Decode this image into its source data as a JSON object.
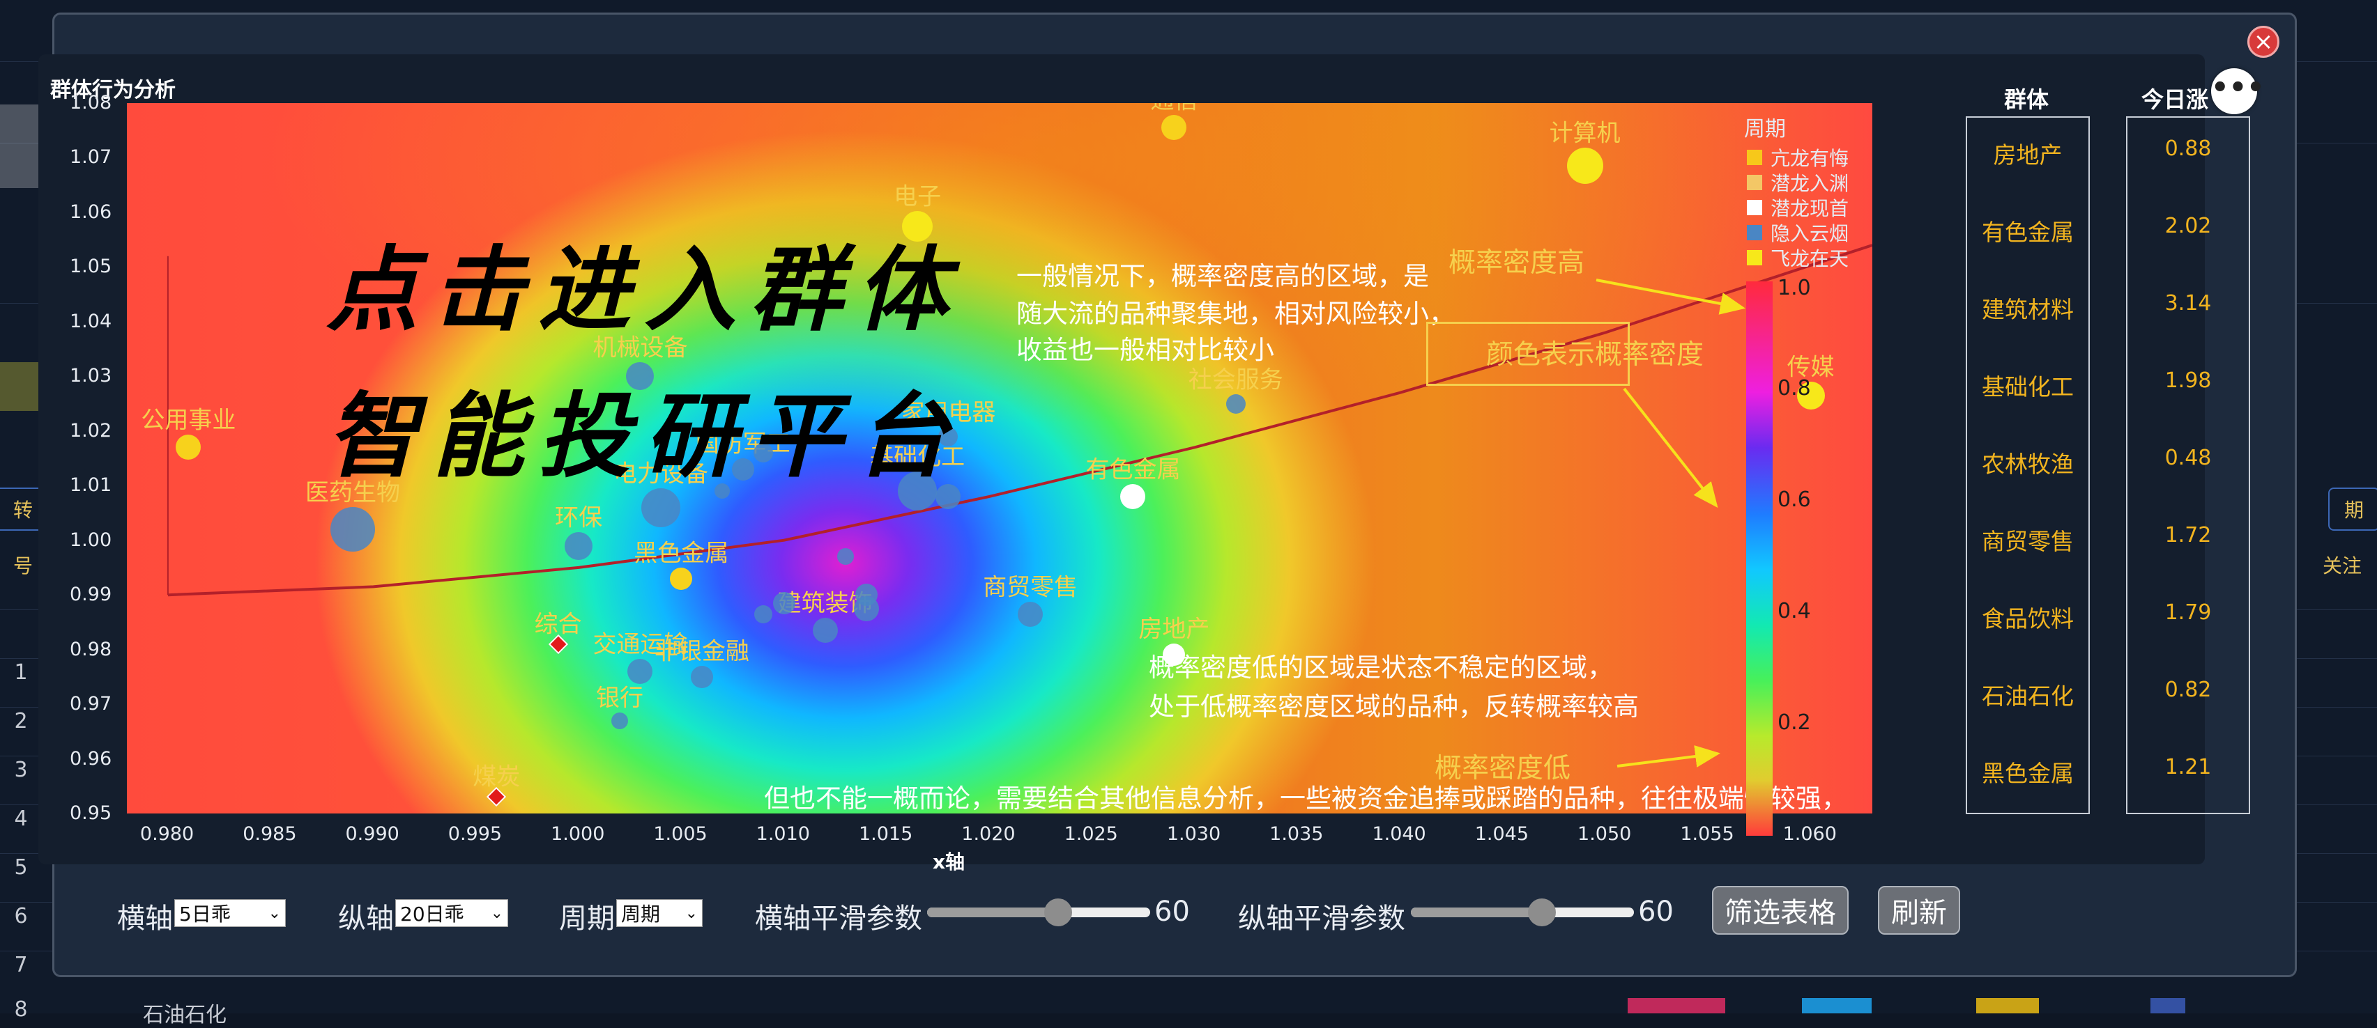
{
  "background": {
    "row_numbers": [
      "1",
      "2",
      "3",
      "4",
      "5",
      "6",
      "7",
      "8"
    ],
    "left_tags": [
      "转",
      "号"
    ],
    "right_tags": [
      "期",
      "关注"
    ],
    "bottom_row_text": "石油石化"
  },
  "modal": {
    "close_label": "×",
    "chart_title": "群体行为分析",
    "plot": {
      "x_axis_title": "x轴",
      "x_ticks": [
        "0.980",
        "0.985",
        "0.990",
        "0.995",
        "1.000",
        "1.005",
        "1.010",
        "1.015",
        "1.020",
        "1.025",
        "1.030",
        "1.035",
        "1.040",
        "1.045",
        "1.050",
        "1.055",
        "1.060"
      ],
      "y_ticks": [
        "1.08",
        "1.07",
        "1.06",
        "1.05",
        "1.04",
        "1.03",
        "1.02",
        "1.01",
        "1.00",
        "0.99",
        "0.98",
        "0.97",
        "0.96",
        "0.95"
      ],
      "promo_line1": "点击进入群体",
      "promo_line2": "智能投研平台",
      "annotations": {
        "high_density_note_1": "一般情况下，概率密度高的区域，是",
        "high_density_note_2": "随大流的品种聚集地，相对风险较小，",
        "high_density_note_3": "收益也一般相对比较小",
        "low_density_note_1": "概率密度低的区域是状态不稳定的区域，",
        "low_density_note_2": "处于低概率密度区域的品种，反转概率较高",
        "bottom_note": "但也不能一概而论，需要结合其他信息分析，一些被资金追捧或踩踏的品种，往往极端性较强，",
        "high_density_label": "概率密度高",
        "color_note": "颜色表示概率密度",
        "low_density_label": "概率密度低"
      }
    },
    "legend": {
      "title": "周期",
      "items": [
        {
          "label": "亢龙有悔",
          "color": "#f7c81a"
        },
        {
          "label": "潜龙入渊",
          "color": "#f3c766"
        },
        {
          "label": "潜龙现首",
          "color": "#ffffff"
        },
        {
          "label": "隐入云烟",
          "color": "#4a86c4"
        },
        {
          "label": "飞龙在天",
          "color": "#f7e81a"
        }
      ]
    },
    "colorbar": {
      "ticks": [
        "1.0",
        "0.8",
        "0.6",
        "0.4",
        "0.2"
      ]
    },
    "table": {
      "header_group": "群体",
      "header_change": "今日涨",
      "rows": [
        {
          "group": "房地产",
          "change": "0.88"
        },
        {
          "group": "有色金属",
          "change": "2.02"
        },
        {
          "group": "建筑材料",
          "change": "3.14"
        },
        {
          "group": "基础化工",
          "change": "1.98"
        },
        {
          "group": "农林牧渔",
          "change": "0.48"
        },
        {
          "group": "商贸零售",
          "change": "1.72"
        },
        {
          "group": "食品饮料",
          "change": "1.79"
        },
        {
          "group": "石油石化",
          "change": "0.82"
        },
        {
          "group": "黑色金属",
          "change": "1.21"
        }
      ]
    },
    "more_label": "•••",
    "controls": {
      "x_axis_label": "横轴",
      "x_axis_value": "5日乖",
      "y_axis_label": "纵轴",
      "y_axis_value": "20日乖",
      "period_label": "周期",
      "period_value": "周期",
      "x_smooth_label": "横轴平滑参数",
      "x_smooth_value": "60",
      "y_smooth_label": "纵轴平滑参数",
      "y_smooth_value": "60",
      "filter_button": "筛选表格",
      "refresh_button": "刷新"
    }
  },
  "chart_data": {
    "type": "scatter",
    "title": "群体行为分析",
    "xlabel": "x轴",
    "ylabel": "",
    "xlim": [
      0.978,
      1.063
    ],
    "ylim": [
      0.95,
      1.08
    ],
    "points": [
      {
        "name": "通信",
        "x": 1.029,
        "y": 1.0755,
        "size": 18,
        "color": "#f7d21c"
      },
      {
        "name": "计算机",
        "x": 1.049,
        "y": 1.0685,
        "size": 26,
        "color": "#f7e81a"
      },
      {
        "name": "电子",
        "x": 1.0165,
        "y": 1.0575,
        "size": 22,
        "color": "#f7e81a"
      },
      {
        "name": "传媒",
        "x": 1.06,
        "y": 1.0265,
        "size": 20,
        "color": "#f7e81a"
      },
      {
        "name": "社会服务",
        "x": 1.032,
        "y": 1.025,
        "size": 14,
        "color": "#4a86c4"
      },
      {
        "name": "公用事业",
        "x": 0.981,
        "y": 1.017,
        "size": 18,
        "color": "#f7d21c"
      },
      {
        "name": "机械设备",
        "x": 1.003,
        "y": 1.03,
        "size": 20,
        "color": "#4a86c4"
      },
      {
        "name": "国防军工",
        "x": 1.008,
        "y": 1.013,
        "size": 16,
        "color": "#4a86c4"
      },
      {
        "name": "家用电器",
        "x": 1.018,
        "y": 1.019,
        "size": 14,
        "color": "#4a86c4"
      },
      {
        "name": "医药生物",
        "x": 0.989,
        "y": 1.002,
        "size": 32,
        "color": "#4a86c4"
      },
      {
        "name": "基础化工",
        "x": 1.0165,
        "y": 1.009,
        "size": 28,
        "color": "#4a86c4"
      },
      {
        "name": "有色金属",
        "x": 1.027,
        "y": 1.008,
        "size": 18,
        "color": "#ffffff"
      },
      {
        "name": "环保",
        "x": 1.0,
        "y": 0.999,
        "size": 20,
        "color": "#4a86c4"
      },
      {
        "name": "电力设备",
        "x": 1.004,
        "y": 1.006,
        "size": 28,
        "color": "#4a86c4"
      },
      {
        "name": "黑色金属",
        "x": 1.005,
        "y": 0.993,
        "size": 16,
        "color": "#f7d21c"
      },
      {
        "name": "商贸零售",
        "x": 1.022,
        "y": 0.9865,
        "size": 18,
        "color": "#4a86c4"
      },
      {
        "name": "建筑装饰",
        "x": 1.012,
        "y": 0.9835,
        "size": 18,
        "color": "#4a86c4"
      },
      {
        "name": "房地产",
        "x": 1.029,
        "y": 0.979,
        "size": 16,
        "color": "#ffffff"
      },
      {
        "name": "综合",
        "x": 0.999,
        "y": 0.981,
        "size": 8,
        "color": "#e21b1b",
        "shape": "diamond"
      },
      {
        "name": "交通运输",
        "x": 1.003,
        "y": 0.976,
        "size": 18,
        "color": "#4a86c4"
      },
      {
        "name": "非银金融",
        "x": 1.006,
        "y": 0.975,
        "size": 16,
        "color": "#4a86c4"
      },
      {
        "name": "银行",
        "x": 1.002,
        "y": 0.967,
        "size": 12,
        "color": "#4a86c4"
      },
      {
        "name": "煤炭",
        "x": 0.996,
        "y": 0.953,
        "size": 8,
        "color": "#e21b1b",
        "shape": "diamond"
      },
      {
        "name": "",
        "x": 1.009,
        "y": 1.016,
        "size": 14,
        "color": "#4a86c4"
      },
      {
        "name": "",
        "x": 1.007,
        "y": 1.009,
        "size": 11,
        "color": "#4a86c4"
      },
      {
        "name": "",
        "x": 1.018,
        "y": 1.008,
        "size": 18,
        "color": "#4a86c4"
      },
      {
        "name": "",
        "x": 1.013,
        "y": 0.997,
        "size": 12,
        "color": "#4a86c4"
      },
      {
        "name": "",
        "x": 1.014,
        "y": 0.99,
        "size": 16,
        "color": "#4a86c4"
      },
      {
        "name": "",
        "x": 1.014,
        "y": 0.9875,
        "size": 18,
        "color": "#4a86c4"
      },
      {
        "name": "",
        "x": 1.01,
        "y": 0.9885,
        "size": 16,
        "color": "#4a86c4"
      },
      {
        "name": "",
        "x": 1.009,
        "y": 0.9865,
        "size": 13,
        "color": "#4a86c4"
      }
    ],
    "trend_line": [
      {
        "x": 0.98,
        "y": 0.99
      },
      {
        "x": 0.99,
        "y": 0.9915
      },
      {
        "x": 1.0,
        "y": 0.995
      },
      {
        "x": 1.01,
        "y": 1.0
      },
      {
        "x": 1.02,
        "y": 1.008
      },
      {
        "x": 1.03,
        "y": 1.017
      },
      {
        "x": 1.04,
        "y": 1.027
      },
      {
        "x": 1.05,
        "y": 1.038
      },
      {
        "x": 1.063,
        "y": 1.054
      }
    ],
    "grid": false,
    "legend_position": "top-right"
  }
}
